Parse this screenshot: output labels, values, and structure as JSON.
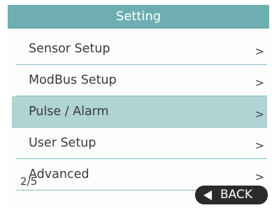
{
  "header": {
    "title": "Setting"
  },
  "menu": {
    "items": [
      {
        "label": "Sensor Setup",
        "arrow": ">"
      },
      {
        "label": "ModBus Setup",
        "arrow": ">"
      },
      {
        "label": "Pulse / Alarm",
        "arrow": ">",
        "selected": true
      },
      {
        "label": "User Setup",
        "arrow": ">"
      },
      {
        "label": "Advanced",
        "arrow": ">"
      }
    ]
  },
  "footer": {
    "page_indicator": "2/5",
    "back_label": "BACK",
    "back_icon": "left-triangle-icon"
  },
  "colors": {
    "header_bg": "#6eaeb1",
    "selected_bg": "#b0d3d3",
    "divider": "#7fc1c4",
    "back_bg": "#2b2b2b"
  }
}
